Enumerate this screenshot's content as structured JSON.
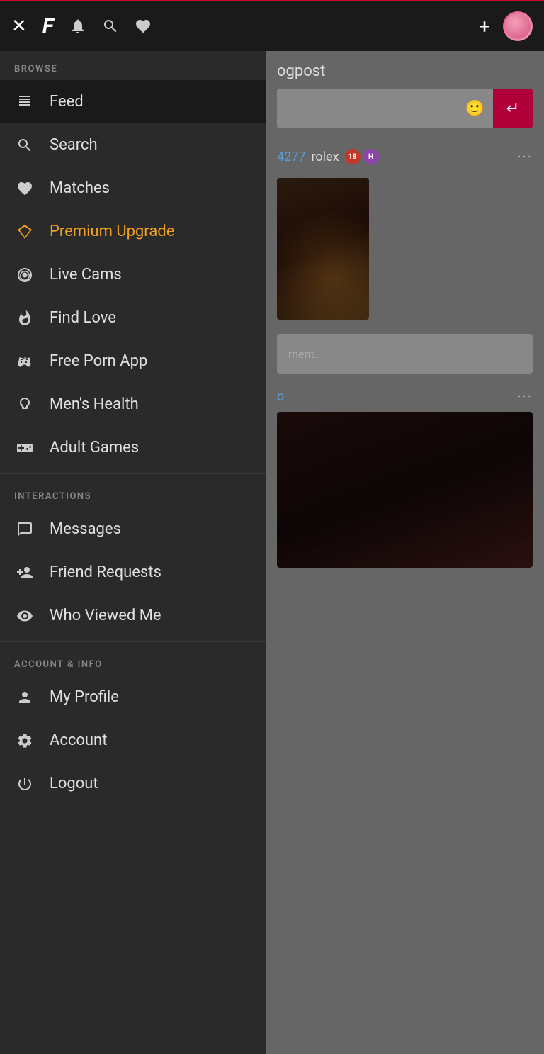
{
  "topbar": {
    "close_label": "✕",
    "logo_label": "F",
    "bell_label": "🔔",
    "search_label": "🔍",
    "heart_label": "♥",
    "plus_label": "+",
    "avatar_alt": "user avatar"
  },
  "sidebar": {
    "browse_label": "BROWSE",
    "interactions_label": "INTERACTIONS",
    "account_label": "ACCOUNT & INFO",
    "items_browse": [
      {
        "id": "feed",
        "label": "Feed",
        "icon": "feed-icon"
      },
      {
        "id": "search",
        "label": "Search",
        "icon": "search-icon"
      },
      {
        "id": "matches",
        "label": "Matches",
        "icon": "heart-icon"
      },
      {
        "id": "premium",
        "label": "Premium Upgrade",
        "icon": "diamond-icon",
        "accent": true
      },
      {
        "id": "live-cams",
        "label": "Live Cams",
        "icon": "camera-icon"
      },
      {
        "id": "find-love",
        "label": "Find Love",
        "icon": "flame-icon"
      },
      {
        "id": "free-porn-app",
        "label": "Free Porn App",
        "icon": "controller-icon"
      },
      {
        "id": "mens-health",
        "label": "Men's Health",
        "icon": "health-icon"
      },
      {
        "id": "adult-games",
        "label": "Adult Games",
        "icon": "gamepad-icon"
      }
    ],
    "items_interactions": [
      {
        "id": "messages",
        "label": "Messages",
        "icon": "message-icon"
      },
      {
        "id": "friend-requests",
        "label": "Friend Requests",
        "icon": "friend-icon"
      },
      {
        "id": "who-viewed-me",
        "label": "Who Viewed Me",
        "icon": "eye-icon"
      }
    ],
    "items_account": [
      {
        "id": "my-profile",
        "label": "My Profile",
        "icon": "profile-icon"
      },
      {
        "id": "account",
        "label": "Account",
        "icon": "gear-icon"
      },
      {
        "id": "logout",
        "label": "Logout",
        "icon": "power-icon"
      }
    ]
  },
  "main": {
    "blogpost_label": "ogpost",
    "comment_placeholder": "ment...",
    "post_id": "4277",
    "post_username": "rolex",
    "badge1": "18",
    "badge2": "H",
    "comment_placeholder2": "comment..."
  }
}
